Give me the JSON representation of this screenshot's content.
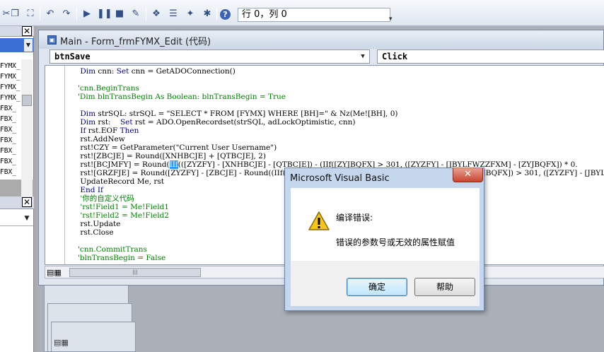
{
  "toolbar": {
    "icons": [
      "scissors-icon",
      "copy-icon",
      "paste-icon",
      "find-icon",
      "undo-icon",
      "redo-icon",
      "run-icon",
      "break-icon",
      "reset-icon",
      "design-mode-icon",
      "project-explorer-icon",
      "properties-icon",
      "object-browser-icon",
      "toolbox-icon",
      "help-icon"
    ],
    "cursor_position": "行 0，列 0"
  },
  "left_panel": {
    "items": [
      "FYMX_",
      "FYMX_",
      "FYMX_",
      "FYMX_",
      "FBX_",
      "FBX_",
      "FBX_",
      "FBX_",
      "FBX_",
      "FBX_",
      "FBX_"
    ]
  },
  "code_window": {
    "title": "Main - Form_frmFYMX_Edit (代码)",
    "object": "btnSave",
    "procedure": "Click",
    "lines": [
      {
        "parts": [
          {
            "t": "    ",
            "c": ""
          },
          {
            "t": "Dim",
            "c": "kw"
          },
          {
            "t": " cnn: ",
            "c": ""
          },
          {
            "t": "Set",
            "c": "kw"
          },
          {
            "t": " cnn = GetADOConnection()",
            "c": ""
          }
        ]
      },
      {
        "parts": [
          {
            "t": "",
            "c": ""
          }
        ]
      },
      {
        "parts": [
          {
            "t": "   'cnn.BeginTrans",
            "c": "cm"
          }
        ]
      },
      {
        "parts": [
          {
            "t": "   'Dim blnTransBegin As Boolean: blnTransBegin = True",
            "c": "cm"
          }
        ]
      },
      {
        "parts": [
          {
            "t": "",
            "c": ""
          }
        ]
      },
      {
        "parts": [
          {
            "t": "    ",
            "c": ""
          },
          {
            "t": "Dim",
            "c": "kw"
          },
          {
            "t": " strSQL: strSQL = \"SELECT * FROM [FYMX] WHERE [BH]=\" & Nz(Me![BH], 0)",
            "c": ""
          }
        ]
      },
      {
        "parts": [
          {
            "t": "    ",
            "c": ""
          },
          {
            "t": "Dim",
            "c": "kw"
          },
          {
            "t": " rst:    ",
            "c": ""
          },
          {
            "t": "Set",
            "c": "kw"
          },
          {
            "t": " rst = ADO.OpenRecordset(strSQL, adLockOptimistic, cnn)",
            "c": ""
          }
        ]
      },
      {
        "parts": [
          {
            "t": "    ",
            "c": ""
          },
          {
            "t": "If",
            "c": "kw"
          },
          {
            "t": " rst.EOF ",
            "c": ""
          },
          {
            "t": "Then",
            "c": "kw"
          }
        ]
      },
      {
        "parts": [
          {
            "t": "    rst.AddNew",
            "c": ""
          }
        ]
      },
      {
        "parts": [
          {
            "t": "    rst!CZY = GetParameter(\"Current User Username\")",
            "c": ""
          }
        ]
      },
      {
        "parts": [
          {
            "t": "    rst![ZBCJE] = Round([XNHBCJE] + [QTBCJE], 2)",
            "c": ""
          }
        ]
      },
      {
        "parts": [
          {
            "t": "    rst![BCJMFY] = Round(",
            "c": ""
          },
          {
            "t": "IIf",
            "c": "hl"
          },
          {
            "t": "(([ZYZFY] - [XNHBCJE] - [QTBCJE]) - (IIf([ZYJBQFX] > 301, ([ZYZFY] - [JBYLFWZZFXM] - [ZYJBQFX]) * 0.",
            "c": ""
          }
        ]
      },
      {
        "parts": [
          {
            "t": "    rst![GRZFJE] = Round([ZYZFY] - [ZBCJE] - Round((IIf([ZYJBQFX] > 301, ([ZYZFY] - [JBYLFWZZFXM] - [ZYJBQFX]) > 301, ([ZYZFY] - [JBYLFW",
            "c": ""
          }
        ]
      },
      {
        "parts": [
          {
            "t": "    UpdateRecord Me, rst",
            "c": ""
          }
        ]
      },
      {
        "parts": [
          {
            "t": "    ",
            "c": ""
          },
          {
            "t": "End If",
            "c": "kw"
          }
        ]
      },
      {
        "parts": [
          {
            "t": "    '你的自定义代码",
            "c": "cm"
          }
        ]
      },
      {
        "parts": [
          {
            "t": "    'rst!Field1 = Me!Field1",
            "c": "cm"
          }
        ]
      },
      {
        "parts": [
          {
            "t": "    'rst!Field2 = Me!Field2",
            "c": "cm"
          }
        ]
      },
      {
        "parts": [
          {
            "t": "    rst.Update",
            "c": ""
          }
        ]
      },
      {
        "parts": [
          {
            "t": "    rst.Close",
            "c": ""
          }
        ]
      },
      {
        "parts": [
          {
            "t": "",
            "c": ""
          }
        ]
      },
      {
        "parts": [
          {
            "t": "   'cnn.CommitTrans",
            "c": "cm"
          }
        ]
      },
      {
        "parts": [
          {
            "t": "   'blnTransBegin = False",
            "c": "cm"
          }
        ]
      }
    ]
  },
  "dialog": {
    "title": "Microsoft Visual Basic",
    "close_label": "✕",
    "heading": "编译错误:",
    "message": "错误的参数号或无效的属性赋值",
    "ok_label": "确定",
    "help_label": "帮助",
    "icon": "warning-icon"
  }
}
